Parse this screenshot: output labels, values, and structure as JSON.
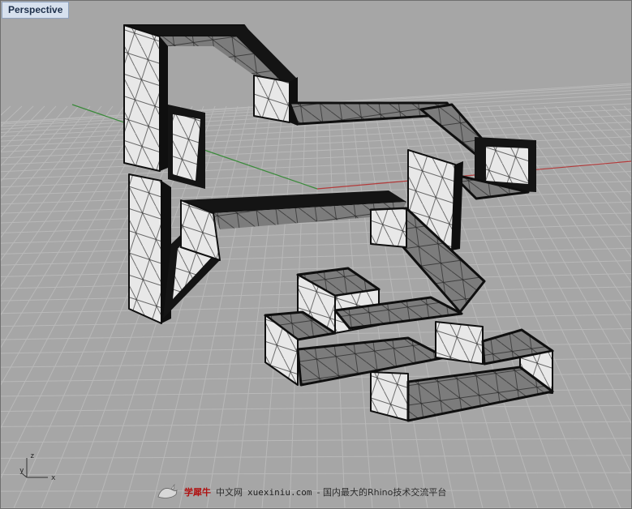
{
  "viewport": {
    "title": "Perspective",
    "axes": {
      "x": "x",
      "y": "y",
      "z": "z"
    }
  },
  "colors": {
    "background": "#a6a6a6",
    "grid": "#b9b9b9",
    "x_axis": "#b33a3a",
    "y_axis": "#3a8a3a",
    "tube_edge": "#0f0f0f",
    "tube_face": "#eaeaea"
  },
  "watermark": {
    "brand": "学犀牛",
    "text": "中文网",
    "url": "xuexiniu.com",
    "tagline": "- 国内最大的Rhino技术交流平台"
  }
}
